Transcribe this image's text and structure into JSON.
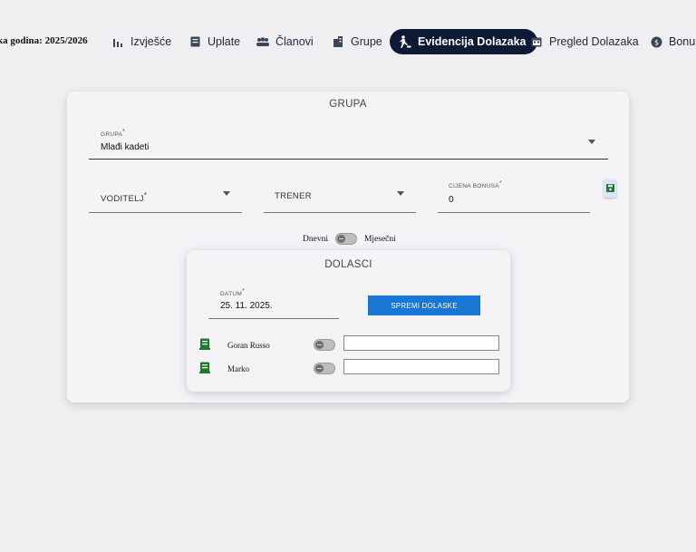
{
  "nav": {
    "season": "ka godina: 2025/2026",
    "items": [
      {
        "label": "Izvješće",
        "icon": "bar-chart-icon"
      },
      {
        "label": "Uplate",
        "icon": "receipt-icon"
      },
      {
        "label": "Članovi",
        "icon": "people-icon"
      },
      {
        "label": "Grupe",
        "icon": "building-icon"
      },
      {
        "label": "Evidencija Dolazaka",
        "icon": "person-walking-icon",
        "active": true
      },
      {
        "label": "Pregled Dolazaka",
        "icon": "calendar-icon"
      },
      {
        "label": "Bonus",
        "icon": "dollar-icon"
      }
    ]
  },
  "group_card": {
    "title": "GRUPA",
    "grupa": {
      "label": "GRUPA",
      "required": "*",
      "value": "Mlađi kadeti"
    },
    "voditelj": {
      "label": "VODITELJ",
      "required": "*"
    },
    "trener": {
      "label": "TRENER"
    },
    "cijena_bonusa": {
      "label": "CIJENA BONUSA",
      "required": "*",
      "value": "0"
    },
    "mode_toggle": {
      "left": "Dnevni",
      "right": "Mjesečni",
      "state": "off"
    }
  },
  "attendance": {
    "title": "DOLASCI",
    "datum": {
      "label": "DATUM",
      "required": "*",
      "value": "25. 11. 2025."
    },
    "save_label": "SPREMI DOLASKE",
    "members": [
      {
        "name": "Goran Russo",
        "present": false,
        "note": ""
      },
      {
        "name": "Marko",
        "present": false,
        "note": ""
      }
    ]
  },
  "colors": {
    "nav_active": "#0e1a33",
    "primary": "#1976d2",
    "save_green": "#1b7a2c"
  }
}
